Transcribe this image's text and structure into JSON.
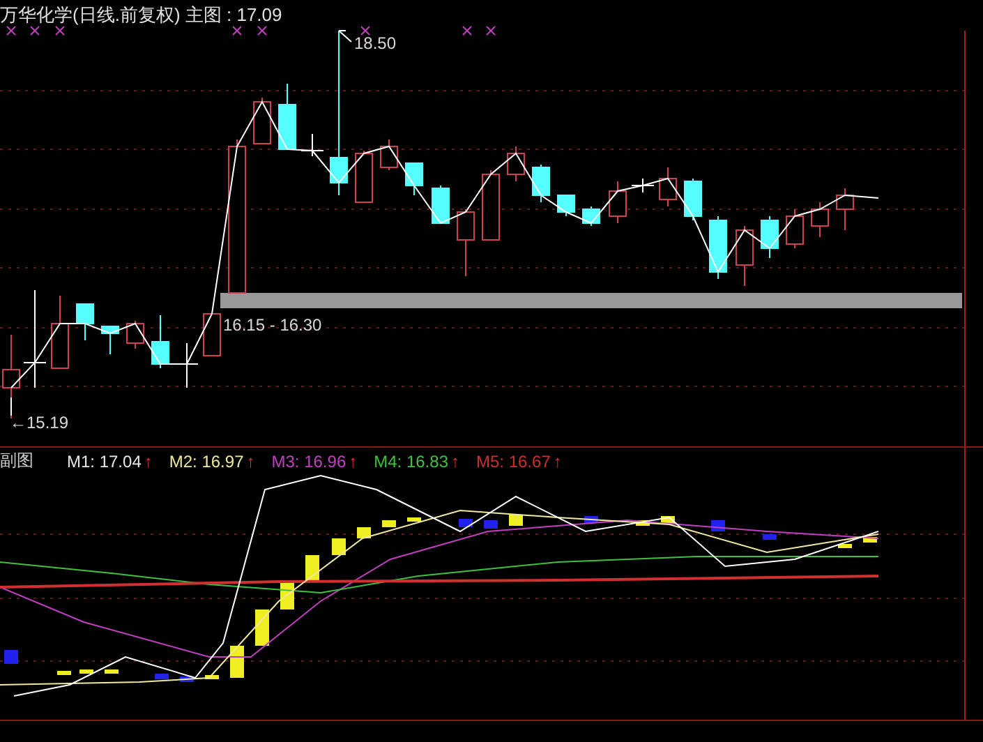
{
  "main_chart": {
    "title": "万华化学(日线.前复权) 主图 : 17.09",
    "annotations": [
      {
        "kind": "high",
        "text": "18.50"
      },
      {
        "kind": "band",
        "text": "16.15 - 16.30"
      },
      {
        "kind": "low",
        "text": "←15.19"
      }
    ]
  },
  "sub_chart": {
    "title": "副图",
    "indicators": [
      {
        "label": "M1: 17.04",
        "arrow": "↑",
        "color": "#e8e8e8"
      },
      {
        "label": "M2: 16.97",
        "arrow": "↑",
        "color": "#f0e8a0"
      },
      {
        "label": "M3: 16.96",
        "arrow": "↑",
        "color": "#c040c0"
      },
      {
        "label": "M4: 16.83",
        "arrow": "↑",
        "color": "#40c040"
      },
      {
        "label": "M5: 16.67",
        "arrow": "↑",
        "color": "#c83030"
      }
    ]
  }
}
